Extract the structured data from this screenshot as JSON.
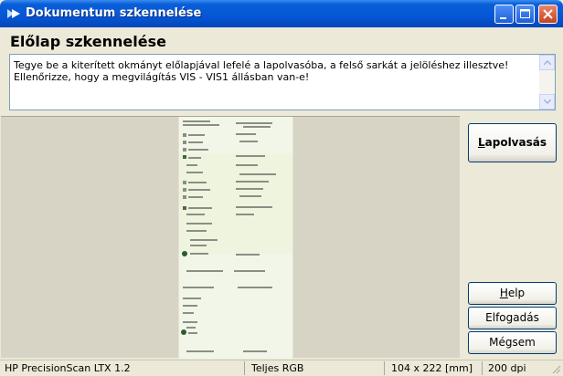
{
  "window": {
    "title": "Dokumentum szkennelése"
  },
  "heading": "Előlap szkennelése",
  "instructions": {
    "line1": "Tegye be a kiterített okmányt előlapjával lefelé a lapolvasóba, a felső sarkát a jelöléshez illesztve!",
    "line2": "Ellenőrizze, hogy a megvilágítás VIS - VIS1 állásban van-e!"
  },
  "buttons": {
    "scan": {
      "label_u": "L",
      "label_rest": "apolvasás"
    },
    "help": {
      "label_u": "H",
      "label_rest": "elp"
    },
    "accept": {
      "label": "Elfogadás"
    },
    "cancel": {
      "label": "Mégsem"
    }
  },
  "status": {
    "scanner": "HP PrecisionScan LTX 1.2",
    "color_mode": "Teljes RGB",
    "size": "104 x 222 [mm]",
    "dpi": "200 dpi"
  },
  "colors": {
    "titlebar": "#0556d6",
    "window_bg": "#ece9d8",
    "preview_bg": "#d7d4c5"
  }
}
